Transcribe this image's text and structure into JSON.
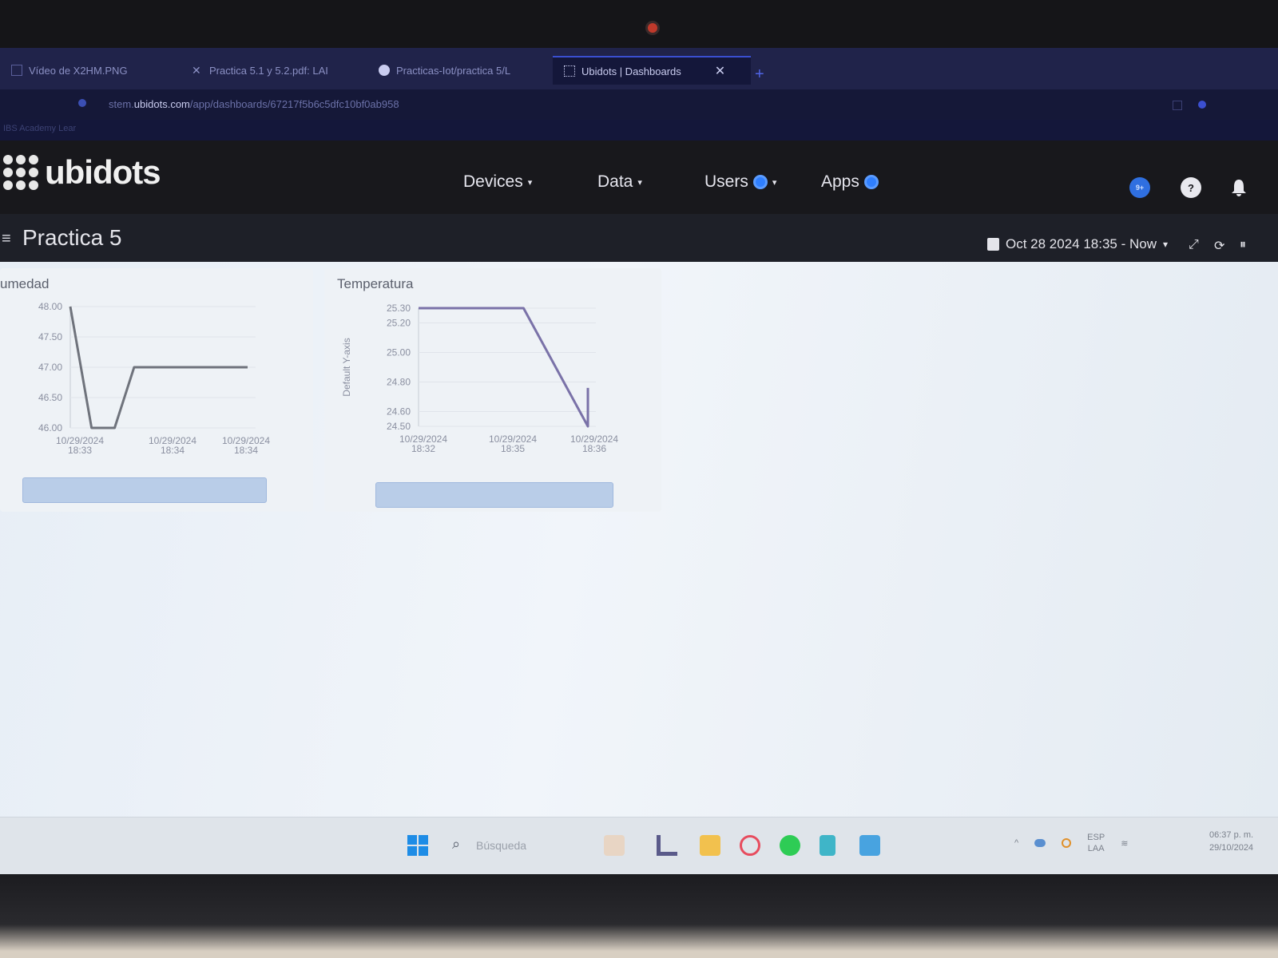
{
  "browser": {
    "tabs": [
      {
        "label": "Vídeo de X2HM.PNG"
      },
      {
        "label": "Practica 5.1 y 5.2.pdf: LAI"
      },
      {
        "label": "Practicas-Iot/practica 5/L"
      },
      {
        "label": "Ubidots | Dashboards",
        "active": true
      }
    ],
    "tab_close": "✕",
    "new_tab": "+",
    "url_prefix": "stem.",
    "url_host": "ubidots.com",
    "url_path": "/app/dashboards/67217f5b6c5dfc10bf0ab958",
    "bookmark": "IBS Academy Lear"
  },
  "app": {
    "brand": "ubidots",
    "nav": [
      {
        "label": "Devices",
        "caret": "▾",
        "badge": false
      },
      {
        "label": "Data",
        "caret": "▾",
        "badge": false
      },
      {
        "label": "Users",
        "caret": "▾",
        "badge": true
      },
      {
        "label": "Apps",
        "caret": "",
        "badge": true
      }
    ],
    "notifications_badge": "9+",
    "help_glyph": "?",
    "bell_glyph": "🔔",
    "page_title": "Practica 5",
    "menu_glyph": "≡",
    "date_range": "Oct 28 2024 18:35 - Now",
    "date_caret": "▾",
    "expand_glyph": "⤢",
    "refresh_glyph": "⟳",
    "pause_glyph": "⏸"
  },
  "widgets": [
    {
      "title": "umedad"
    },
    {
      "title": "Temperatura",
      "ylabel": "Default Y-axis"
    }
  ],
  "chart_data": [
    {
      "type": "line",
      "title": "umedad",
      "yticks": [
        "48.00",
        "47.50",
        "47.00",
        "46.50",
        "46.00"
      ],
      "ylim": [
        46.0,
        48.0
      ],
      "xticks": [
        {
          "date": "10/29/2024",
          "time": "18:33"
        },
        {
          "date": "10/29/2024",
          "time": "18:34"
        },
        {
          "date": "10/29/2024",
          "time": "18:34"
        }
      ],
      "series": [
        {
          "x": [
            0.0,
            0.12,
            0.25,
            0.36,
            1.0
          ],
          "values": [
            48.0,
            46.0,
            46.0,
            47.0,
            47.0
          ]
        }
      ],
      "line_color": "#6f737c"
    },
    {
      "type": "line",
      "title": "Temperatura",
      "ylabel": "Default Y-axis",
      "yticks": [
        "25.30",
        "25.20",
        "25.00",
        "24.80",
        "24.60",
        "24.50"
      ],
      "ylim": [
        24.5,
        25.3
      ],
      "xticks": [
        {
          "date": "10/29/2024",
          "time": "18:32"
        },
        {
          "date": "10/29/2024",
          "time": "18:35"
        },
        {
          "date": "10/29/2024",
          "time": "18:36"
        }
      ],
      "series": [
        {
          "x": [
            0.0,
            0.62,
            1.0,
            1.0
          ],
          "values": [
            25.3,
            25.3,
            24.5,
            24.76
          ]
        }
      ],
      "line_color": "#7a72a8"
    }
  ],
  "taskbar": {
    "search_placeholder": "Búsqueda",
    "tray_lang": "ESP",
    "tray_region": "LAA",
    "clock_time": "06:37 p. m.",
    "clock_date": "29/10/2024",
    "tray_caret": "^"
  }
}
